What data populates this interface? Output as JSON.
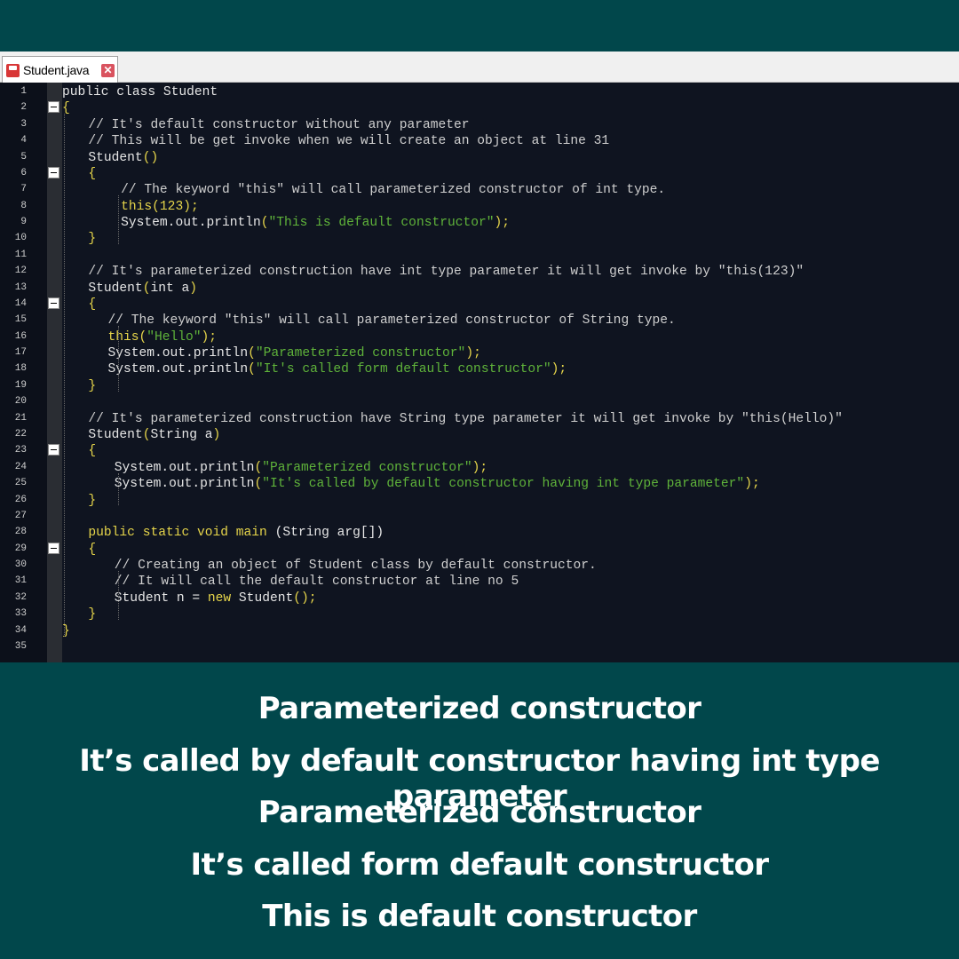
{
  "tab": {
    "filename": "Student.java",
    "close_symbol": "✕"
  },
  "colors": {
    "background": "#01474b",
    "editor_bg": "#0f1420",
    "keyword": "#e6d54a",
    "string": "#5fb33a",
    "comment": "#cfcfcf",
    "default": "#e6e6e6"
  },
  "code": {
    "lines": [
      {
        "n": "1",
        "fold": false,
        "indent": 0,
        "tokens": [
          [
            "public class Student",
            "d"
          ]
        ]
      },
      {
        "n": "2",
        "fold": true,
        "indent": 0,
        "tokens": [
          [
            "{",
            "k"
          ]
        ]
      },
      {
        "n": "3",
        "fold": false,
        "indent": 4,
        "tokens": [
          [
            "// It's default constructor without any parameter",
            "c"
          ]
        ]
      },
      {
        "n": "4",
        "fold": false,
        "indent": 4,
        "tokens": [
          [
            "// This will be get invoke when we will create an object at line 31",
            "c"
          ]
        ]
      },
      {
        "n": "5",
        "fold": false,
        "indent": 4,
        "tokens": [
          [
            "Student",
            "d"
          ],
          [
            "()",
            "k"
          ]
        ]
      },
      {
        "n": "6",
        "fold": true,
        "indent": 4,
        "tokens": [
          [
            "{",
            "k"
          ]
        ]
      },
      {
        "n": "7",
        "fold": false,
        "indent": 9,
        "tokens": [
          [
            "// The keyword \"this\" will call parameterized constructor of int type.",
            "c"
          ]
        ]
      },
      {
        "n": "8",
        "fold": false,
        "indent": 9,
        "tokens": [
          [
            "this(123);",
            "k"
          ]
        ]
      },
      {
        "n": "9",
        "fold": false,
        "indent": 9,
        "tokens": [
          [
            "System.out.println",
            "d"
          ],
          [
            "(",
            "k"
          ],
          [
            "\"This is default constructor\"",
            "s"
          ],
          [
            ");",
            "k"
          ]
        ]
      },
      {
        "n": "10",
        "fold": false,
        "indent": 4,
        "tokens": [
          [
            "}",
            "k"
          ]
        ]
      },
      {
        "n": "11",
        "fold": false,
        "indent": 0,
        "tokens": []
      },
      {
        "n": "12",
        "fold": false,
        "indent": 4,
        "tokens": [
          [
            "// It's parameterized construction have int type parameter it will get invoke by \"this(123)\"",
            "c"
          ]
        ]
      },
      {
        "n": "13",
        "fold": false,
        "indent": 4,
        "tokens": [
          [
            "Student",
            "d"
          ],
          [
            "(",
            "k"
          ],
          [
            "int a",
            "d"
          ],
          [
            ")",
            "k"
          ]
        ]
      },
      {
        "n": "14",
        "fold": true,
        "indent": 4,
        "tokens": [
          [
            "{",
            "k"
          ]
        ]
      },
      {
        "n": "15",
        "fold": false,
        "indent": 7,
        "tokens": [
          [
            "// The keyword \"this\" will call parameterized constructor of String type.",
            "c"
          ]
        ]
      },
      {
        "n": "16",
        "fold": false,
        "indent": 7,
        "tokens": [
          [
            "this(",
            "k"
          ],
          [
            "\"Hello\"",
            "s"
          ],
          [
            ");",
            "k"
          ]
        ]
      },
      {
        "n": "17",
        "fold": false,
        "indent": 7,
        "tokens": [
          [
            "System.out.println",
            "d"
          ],
          [
            "(",
            "k"
          ],
          [
            "\"Parameterized constructor\"",
            "s"
          ],
          [
            ");",
            "k"
          ]
        ]
      },
      {
        "n": "18",
        "fold": false,
        "indent": 7,
        "tokens": [
          [
            "System.out.println",
            "d"
          ],
          [
            "(",
            "k"
          ],
          [
            "\"It's called form default constructor\"",
            "s"
          ],
          [
            ");",
            "k"
          ]
        ]
      },
      {
        "n": "19",
        "fold": false,
        "indent": 4,
        "tokens": [
          [
            "}",
            "k"
          ]
        ]
      },
      {
        "n": "20",
        "fold": false,
        "indent": 0,
        "tokens": []
      },
      {
        "n": "21",
        "fold": false,
        "indent": 4,
        "tokens": [
          [
            "// It's parameterized construction have String type parameter it will get invoke by \"this(Hello)\"",
            "c"
          ]
        ]
      },
      {
        "n": "22",
        "fold": false,
        "indent": 4,
        "tokens": [
          [
            "Student",
            "d"
          ],
          [
            "(",
            "k"
          ],
          [
            "String a",
            "d"
          ],
          [
            ")",
            "k"
          ]
        ]
      },
      {
        "n": "23",
        "fold": true,
        "indent": 4,
        "tokens": [
          [
            "{",
            "k"
          ]
        ]
      },
      {
        "n": "24",
        "fold": false,
        "indent": 8,
        "tokens": [
          [
            "System.out.println",
            "d"
          ],
          [
            "(",
            "k"
          ],
          [
            "\"Parameterized constructor\"",
            "s"
          ],
          [
            ");",
            "k"
          ]
        ]
      },
      {
        "n": "25",
        "fold": false,
        "indent": 8,
        "tokens": [
          [
            "System.out.println",
            "d"
          ],
          [
            "(",
            "k"
          ],
          [
            "\"It's called by default constructor having int type parameter\"",
            "s"
          ],
          [
            ");",
            "k"
          ]
        ]
      },
      {
        "n": "26",
        "fold": false,
        "indent": 4,
        "tokens": [
          [
            "}",
            "k"
          ]
        ]
      },
      {
        "n": "27",
        "fold": false,
        "indent": 0,
        "tokens": []
      },
      {
        "n": "28",
        "fold": false,
        "indent": 4,
        "tokens": [
          [
            "public static void main ",
            "k"
          ],
          [
            "(String arg[])",
            "d"
          ]
        ]
      },
      {
        "n": "29",
        "fold": true,
        "indent": 4,
        "tokens": [
          [
            "{",
            "k"
          ]
        ]
      },
      {
        "n": "30",
        "fold": false,
        "indent": 8,
        "tokens": [
          [
            "// Creating an object of Student class by default constructor.",
            "c"
          ]
        ]
      },
      {
        "n": "31",
        "fold": false,
        "indent": 8,
        "tokens": [
          [
            "// It will call the default constructor at line no 5",
            "c"
          ]
        ]
      },
      {
        "n": "32",
        "fold": false,
        "indent": 8,
        "tokens": [
          [
            "Student n = ",
            "d"
          ],
          [
            "new",
            "k"
          ],
          [
            " Student",
            "d"
          ],
          [
            "();",
            "k"
          ]
        ]
      },
      {
        "n": "33",
        "fold": false,
        "indent": 4,
        "tokens": [
          [
            "}",
            "k"
          ]
        ]
      },
      {
        "n": "34",
        "fold": false,
        "indent": 0,
        "tokens": [
          [
            "}",
            "k"
          ]
        ]
      },
      {
        "n": "35",
        "fold": false,
        "indent": 0,
        "tokens": []
      }
    ]
  },
  "output": {
    "lines": [
      "Parameterized constructor",
      "It’s called by default constructor having int type parameter",
      "Parameterized constructor",
      "It’s called form default constructor",
      "This is default constructor"
    ]
  }
}
